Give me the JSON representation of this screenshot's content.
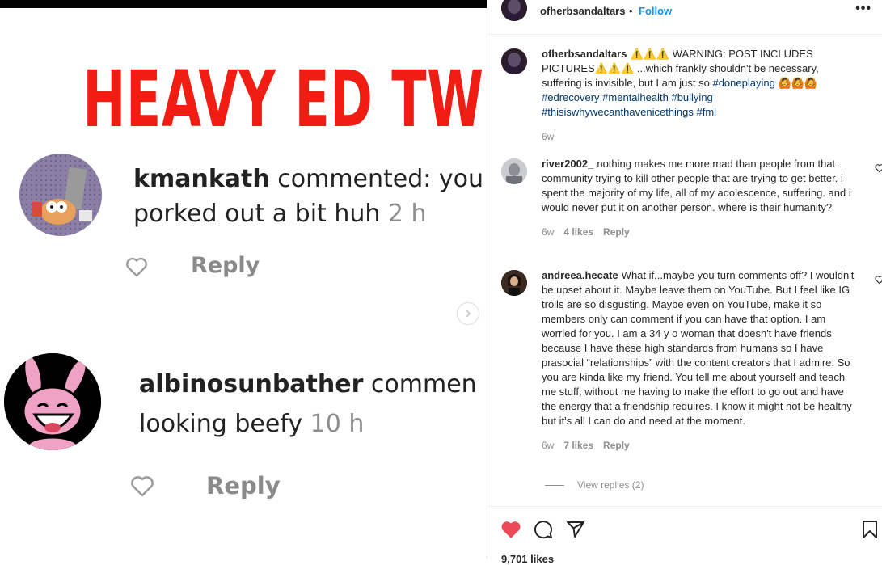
{
  "image": {
    "headline": "HEAVY ED TW",
    "comments": [
      {
        "username": "kmankath",
        "verb": " commented: you",
        "line2": "porked out a bit huh ",
        "time": "2 h",
        "reply": "Reply"
      },
      {
        "username": "albinosunbather",
        "verb": " commen",
        "line2": "looking beefy ",
        "time": "10 h",
        "reply": "Reply"
      }
    ]
  },
  "post": {
    "username": "ofherbsandaltars",
    "dot": "•",
    "follow": "Follow",
    "more": "•••"
  },
  "caption": {
    "username": "ofherbsandaltars",
    "text_a": "⚠️⚠️⚠️ WARNING: POST INCLUDES PICTURES⚠️⚠️⚠️ ...which frankly shouldn't be necessary, suffering is invisible, but I am just so ",
    "tag_1": "#doneplaying",
    "text_b": " 🙆🙆🙆",
    "tags_rest": [
      "#edrecovery",
      "#mentalhealth",
      "#bullying",
      "#thisiswhywecanthavenicethings",
      "#fml"
    ],
    "time": "6w"
  },
  "comments": [
    {
      "username": "river2002_",
      "text": "nothing makes me more mad than people from that community trying to kill other people that are trying to get better. i spent the majority of my life, all of my adolescence, suffering. and i would never put it on another person. where is their humanity?",
      "time": "6w",
      "likes": "4 likes",
      "reply": "Reply"
    },
    {
      "username": "andreea.hecate",
      "text": "What if...maybe you turn comments off? I wouldn't be upset about it. Maybe leave them on YouTube. But I feel like IG trolls are so disgusting. Maybe even on YouTube, make it so members only can comment if you can have that option. I am worried for you. I am a 34 y o woman that doesn't have friends because I have these high standards from humans so I have prasocial “relationships” with the content creators that I admire. So you are kinda like my friend. You tell me about yourself and teach me stuff, without me having to make the effort to go out and have the energy that a friendship requires. I know it might not be healthy but it's all I can do and need at the moment.",
      "time": "6w",
      "likes": "7 likes",
      "reply": "Reply",
      "view_replies": "View replies (2)"
    }
  ],
  "footer": {
    "likes_text": "9,701 likes"
  },
  "colors": {
    "like_red": "#ed4956",
    "link_blue": "#0095f6",
    "tag_blue": "#00376b",
    "headline_red": "#f21d12"
  }
}
